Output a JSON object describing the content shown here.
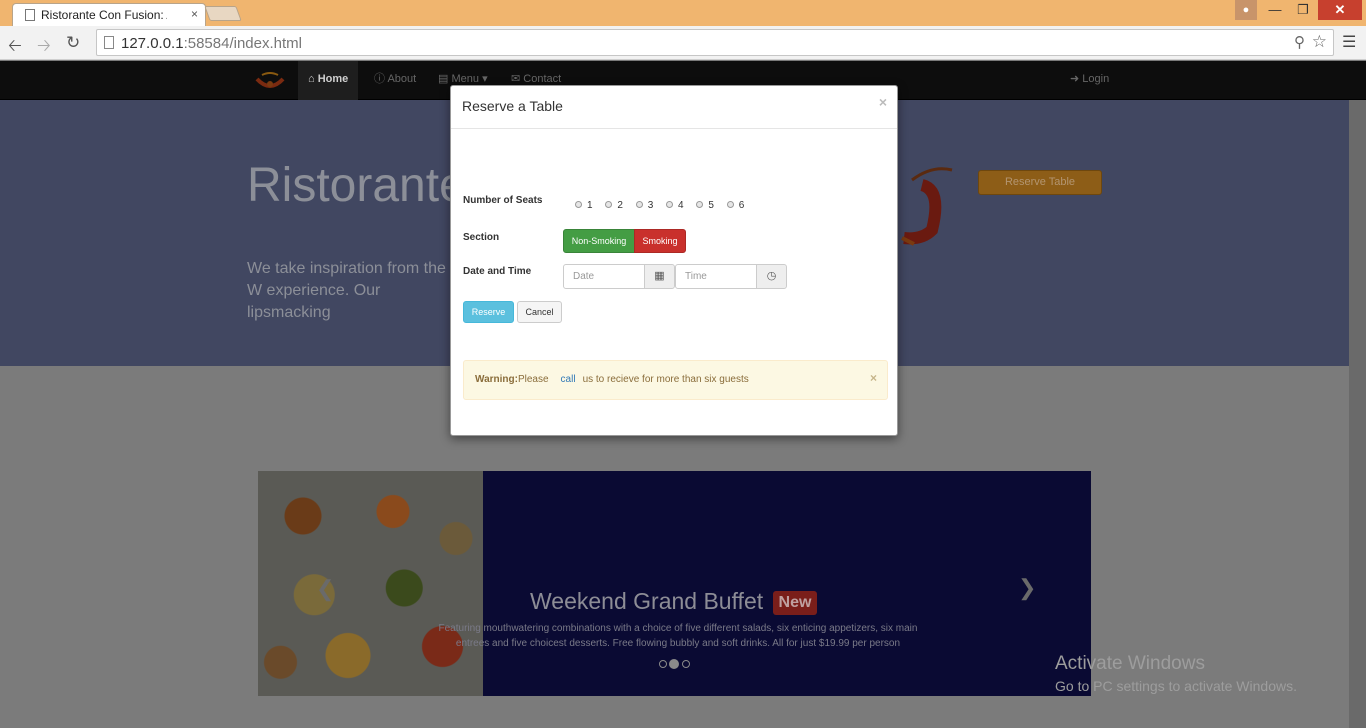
{
  "browser": {
    "tab_title": "Ristorante Con Fusion: Ab",
    "tab_close": "×",
    "url_host": "127.0.0.1",
    "url_rest": ":58584/index.html"
  },
  "navbar": {
    "home": "Home",
    "about": "About",
    "menu": "Menu",
    "contact": "Contact",
    "login": "Login"
  },
  "jumbotron": {
    "title": "Ristorante",
    "text": "We take inspiration from the W experience. Our lipsmacking",
    "reserve_button": "Reserve Table"
  },
  "modal": {
    "title": "Reserve a Table",
    "close": "×",
    "seats_label": "Number of Seats",
    "seats": [
      "1",
      "2",
      "3",
      "4",
      "5",
      "6"
    ],
    "section_label": "Section",
    "non_smoking": "Non-Smoking",
    "smoking": "Smoking",
    "datetime_label": "Date and Time",
    "date_placeholder": "Date",
    "time_placeholder": "Time",
    "reserve": "Reserve",
    "cancel": "Cancel",
    "warning_strong": "Warning:",
    "warning_pre": "Please",
    "warning_link": "call",
    "warning_post": "us to recieve for more than six guests",
    "alert_close": "×"
  },
  "carousel": {
    "title": "Weekend Grand Buffet",
    "badge": "New",
    "caption": "Featuring mouthwatering combinations with a choice of five different salads, six enticing appetizers, six main entrees and five choicest desserts. Free flowing bubbly and soft drinks. All for just $19.99 per person",
    "active_slide": 1
  },
  "watermark": {
    "title": "Activate Windows",
    "subtitle": "Go to PC settings to activate Windows."
  },
  "colors": {
    "titlebar": "#f0b56f",
    "jumbotron": "#414761",
    "non_smoking": "#449d44",
    "smoking": "#c9302c",
    "reserve": "#5bc0de"
  }
}
